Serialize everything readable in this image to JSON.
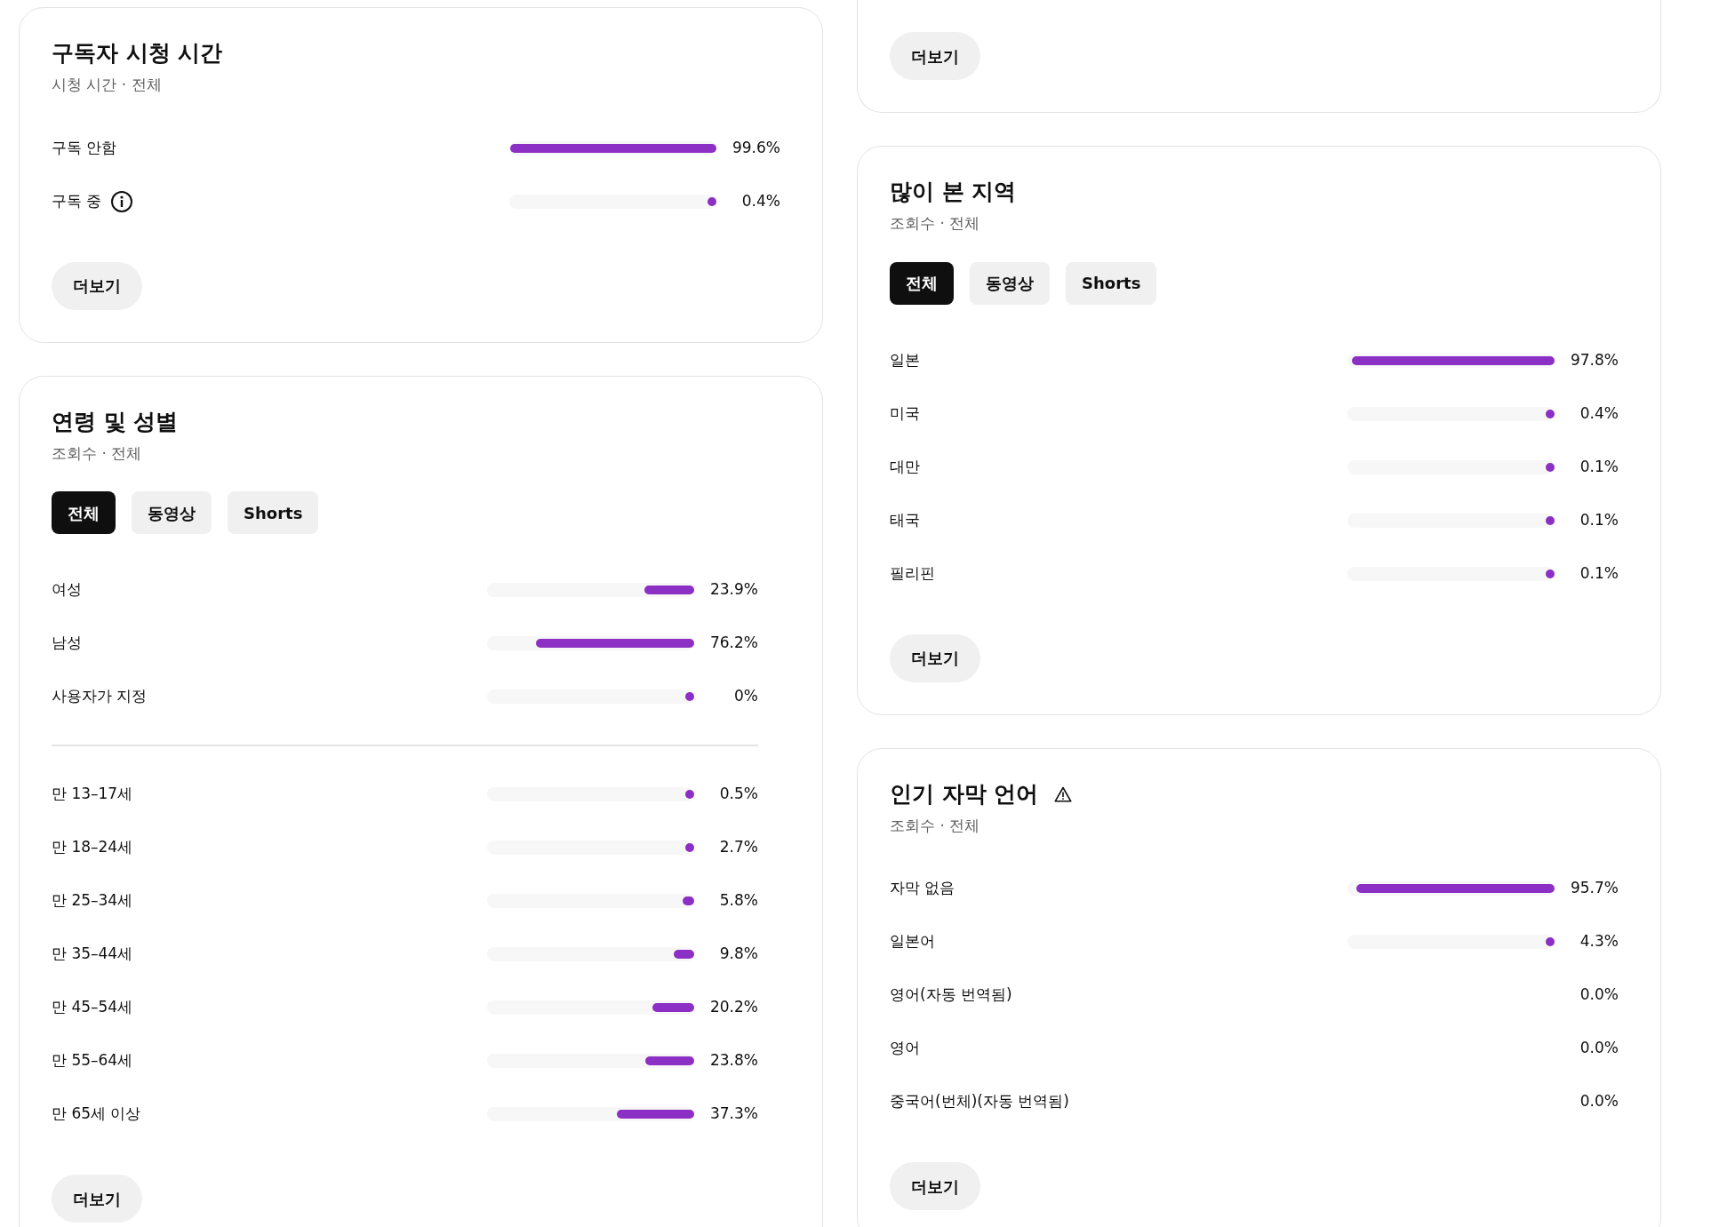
{
  "left_column": [
    {
      "kind": "plain",
      "title": "구독자 시청 시간",
      "subtitle": "시청 시간 · 전체",
      "groups": [
        [
          {
            "kind": "plain",
            "label": "구독 안함",
            "level": 0.996,
            "value": "99.6%"
          },
          {
            "kind": "info",
            "label": "구독 중",
            "level": 0.004,
            "value": "0.4%"
          }
        ]
      ],
      "button": "더보기"
    },
    {
      "kind": "narrow",
      "title": "연령 및 성별",
      "subtitle": "조회수 · 전체",
      "filters": [
        {
          "label": "전체",
          "selected": true
        },
        {
          "label": "동영상",
          "selected": false
        },
        {
          "label": "Shorts",
          "selected": false
        }
      ],
      "groups": [
        [
          {
            "kind": "plain",
            "label": "여성",
            "level": 0.239,
            "value": "23.9%"
          },
          {
            "kind": "plain",
            "label": "남성",
            "level": 0.762,
            "value": "76.2%"
          },
          {
            "kind": "plain",
            "label": "사용자가 지정",
            "level": 0,
            "value": "0%"
          }
        ],
        [
          {
            "kind": "plain",
            "label": "만 13–17세",
            "level": 0.005,
            "value": "0.5%"
          },
          {
            "kind": "plain",
            "label": "만 18–24세",
            "level": 0.027,
            "value": "2.7%"
          },
          {
            "kind": "plain",
            "label": "만 25–34세",
            "level": 0.058,
            "value": "5.8%"
          },
          {
            "kind": "plain",
            "label": "만 35–44세",
            "level": 0.098,
            "value": "9.8%"
          },
          {
            "kind": "plain",
            "label": "만 45–54세",
            "level": 0.202,
            "value": "20.2%"
          },
          {
            "kind": "plain",
            "label": "만 55–64세",
            "level": 0.238,
            "value": "23.8%"
          },
          {
            "kind": "plain",
            "label": "만 65세 이상",
            "level": 0.373,
            "value": "37.3%"
          }
        ]
      ],
      "button": "더보기"
    }
  ],
  "right_column": [
    {
      "kind": "clipped",
      "button": "더보기"
    },
    {
      "kind": "plain",
      "title": "많이 본 지역",
      "subtitle": "조회수 · 전체",
      "filters": [
        {
          "label": "전체",
          "selected": true
        },
        {
          "label": "동영상",
          "selected": false
        },
        {
          "label": "Shorts",
          "selected": false
        }
      ],
      "groups": [
        [
          {
            "kind": "plain",
            "label": "일본",
            "level": 0.978,
            "value": "97.8%"
          },
          {
            "kind": "plain",
            "label": "미국",
            "level": 0.004,
            "value": "0.4%"
          },
          {
            "kind": "plain",
            "label": "대만",
            "level": 0.001,
            "value": "0.1%"
          },
          {
            "kind": "plain",
            "label": "태국",
            "level": 0.001,
            "value": "0.1%"
          },
          {
            "kind": "plain",
            "label": "필리핀",
            "level": 0.001,
            "value": "0.1%"
          }
        ]
      ],
      "button": "더보기"
    },
    {
      "kind": "warning",
      "title": "인기 자막 언어",
      "subtitle": "조회수 · 전체",
      "groups": [
        [
          {
            "kind": "plain",
            "label": "자막 없음",
            "level": 0.957,
            "value": "95.7%"
          },
          {
            "kind": "plain",
            "label": "일본어",
            "level": 0.043,
            "value": "4.3%"
          },
          {
            "kind": "plain",
            "label": "영어(자동 번역됨)",
            "value": "0.0%"
          },
          {
            "kind": "plain",
            "label": "영어",
            "value": "0.0%"
          },
          {
            "kind": "plain",
            "label": "중국어(번체)(자동 번역됨)",
            "value": "0.0%"
          }
        ]
      ],
      "button": "더보기"
    }
  ]
}
